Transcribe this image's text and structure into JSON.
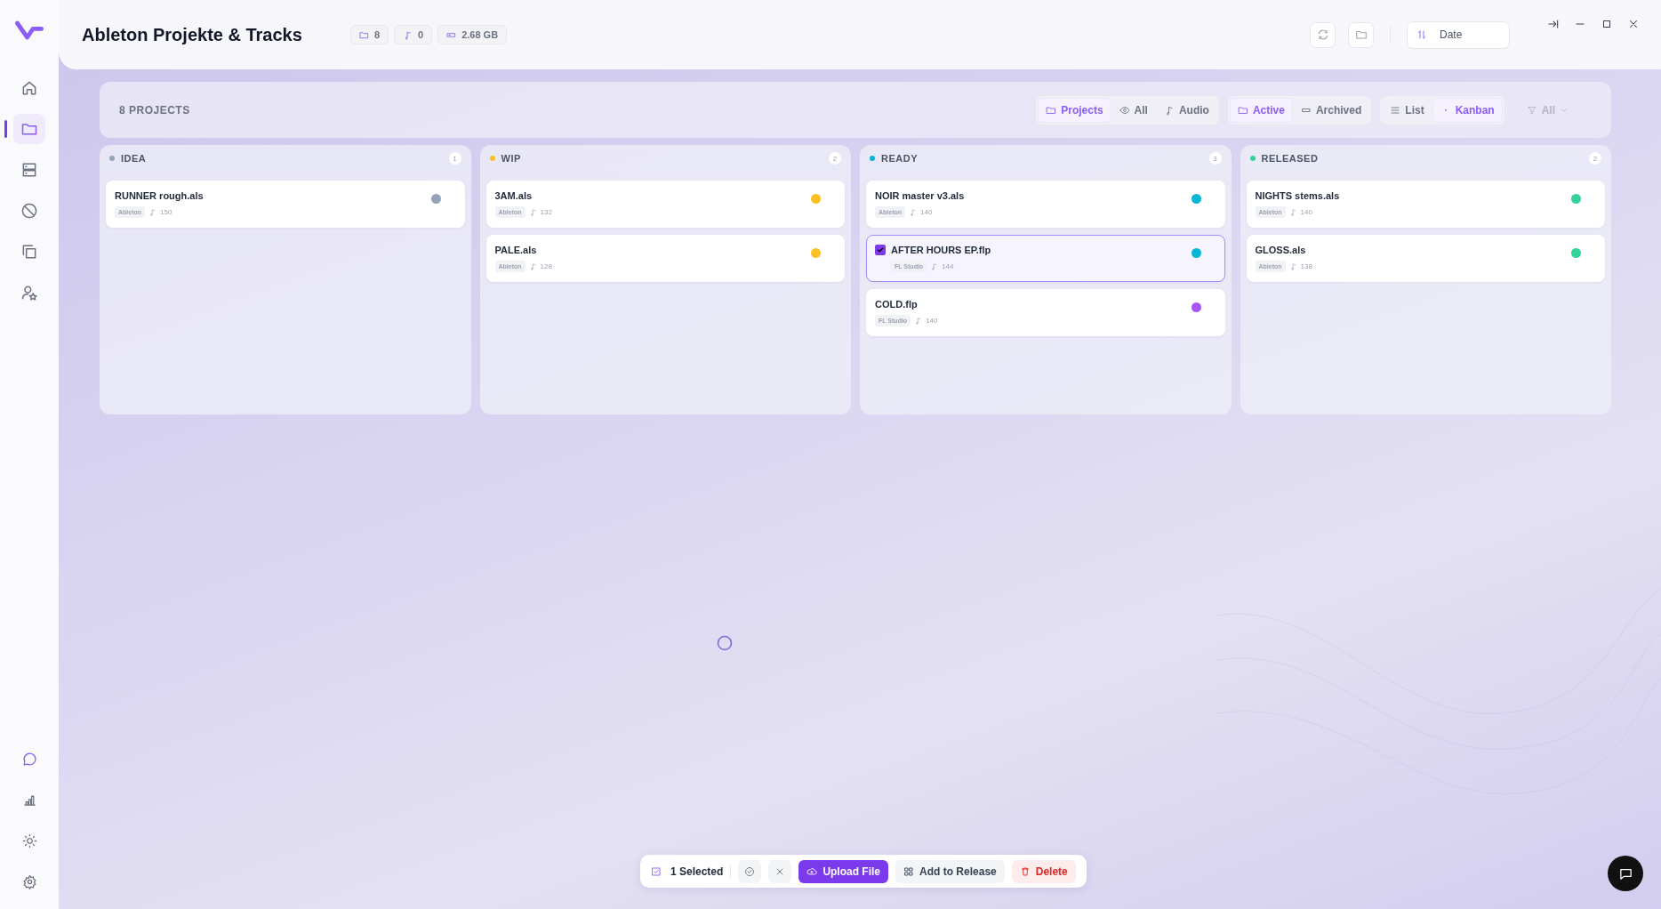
{
  "sidebar": {
    "top": [
      {
        "kind": "home",
        "selected": false
      },
      {
        "kind": "folder",
        "selected": true
      },
      {
        "kind": "server",
        "selected": false
      },
      {
        "kind": "ban",
        "selected": false
      },
      {
        "kind": "copy",
        "selected": false
      },
      {
        "kind": "user-star",
        "selected": false
      }
    ],
    "bottom": [
      {
        "kind": "chat",
        "selected": true
      },
      {
        "kind": "chart",
        "selected": false
      },
      {
        "kind": "sun",
        "selected": false
      },
      {
        "kind": "gear",
        "selected": false
      }
    ]
  },
  "header": {
    "title": "Ableton Projekte & Tracks",
    "stats": [
      {
        "kind": "folder",
        "value": "8"
      },
      {
        "kind": "note",
        "value": "0"
      },
      {
        "kind": "drive",
        "value": "2.68 GB"
      }
    ],
    "sort": "Date"
  },
  "toolbar": {
    "count": "8 PROJECTS",
    "groups": [
      [
        {
          "kind": "folder",
          "label": "Projects",
          "selected": true
        },
        {
          "kind": "eye",
          "label": "All",
          "selected": false
        },
        {
          "kind": "note",
          "label": "Audio",
          "selected": false
        }
      ],
      [
        {
          "kind": "folder",
          "label": "Active",
          "selected": true
        },
        {
          "kind": "archive",
          "label": "Archived",
          "selected": false
        }
      ],
      [
        {
          "kind": "list",
          "label": "List",
          "selected": false
        },
        {
          "kind": "dot",
          "label": "Kanban",
          "selected": true
        }
      ]
    ],
    "filter": "All"
  },
  "columns": [
    {
      "title": "IDEA",
      "color": "#94a3b8",
      "count": "1",
      "cards": [
        {
          "name": "RUNNER rough.als",
          "daw": "Ableton",
          "bpm": "150",
          "color": "#94a3b8",
          "selected": false
        }
      ]
    },
    {
      "title": "WIP",
      "color": "#fbbf24",
      "count": "2",
      "cards": [
        {
          "name": "3AM.als",
          "daw": "Ableton",
          "bpm": "132",
          "color": "#fbbf24",
          "selected": false
        },
        {
          "name": "PALE.als",
          "daw": "Ableton",
          "bpm": "128",
          "color": "#fbbf24",
          "selected": false
        }
      ]
    },
    {
      "title": "READY",
      "color": "#06b6d4",
      "count": "3",
      "cards": [
        {
          "name": "NOIR master v3.als",
          "daw": "Ableton",
          "bpm": "140",
          "color": "#06b6d4",
          "selected": false
        },
        {
          "name": "AFTER HOURS EP.flp",
          "daw": "FL Studio",
          "bpm": "144",
          "color": "#06b6d4",
          "selected": true
        },
        {
          "name": "COLD.flp",
          "daw": "FL Studio",
          "bpm": "140",
          "color": "#a855f7",
          "selected": false
        }
      ]
    },
    {
      "title": "RELEASED",
      "color": "#34d399",
      "count": "2",
      "cards": [
        {
          "name": "NIGHTS stems.als",
          "daw": "Ableton",
          "bpm": "140",
          "color": "#34d399",
          "selected": false
        },
        {
          "name": "GLOSS.als",
          "daw": "Ableton",
          "bpm": "138",
          "color": "#34d399",
          "selected": false
        }
      ]
    }
  ],
  "bulk": {
    "selected": "1 Selected",
    "actions": [
      {
        "kind": "primary",
        "label": "Upload File"
      },
      {
        "kind": "plain",
        "label": "Add to Release"
      },
      {
        "kind": "danger",
        "label": "Delete"
      }
    ]
  }
}
